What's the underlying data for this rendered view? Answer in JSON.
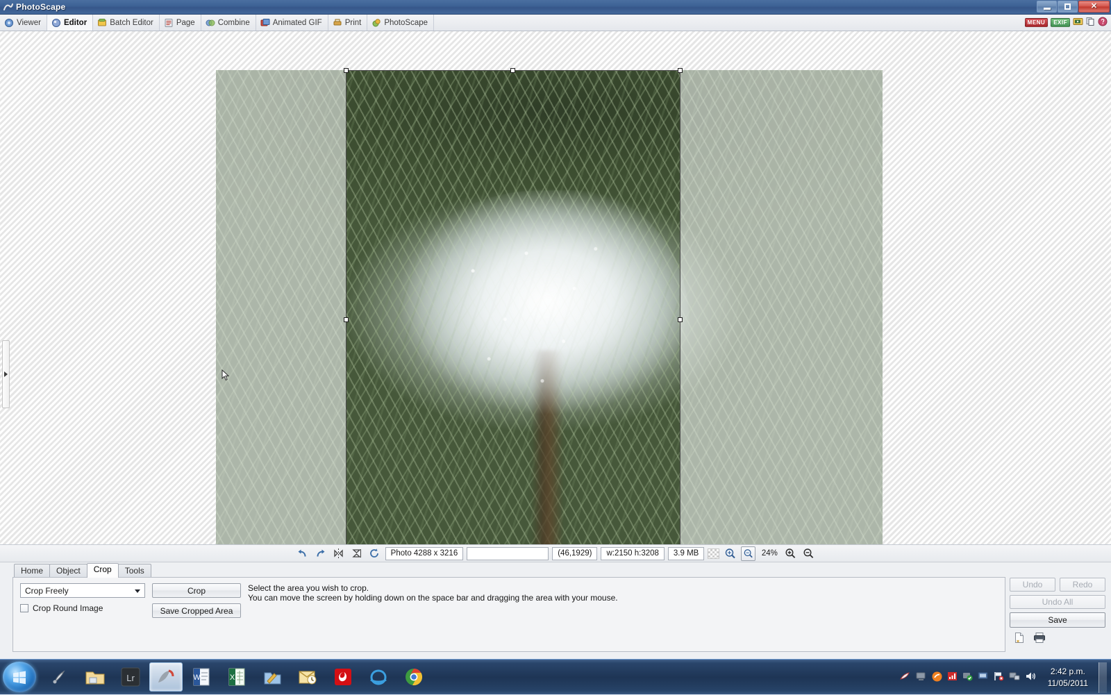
{
  "window": {
    "title": "PhotoScape",
    "icon": "photoscape-logo-icon",
    "controls": {
      "minimize": "minimize-button",
      "restore": "restore-button",
      "close": "close-button"
    }
  },
  "modebar": {
    "items": [
      {
        "label": "Viewer",
        "icon": "viewer-icon",
        "active": false
      },
      {
        "label": "Editor",
        "icon": "editor-icon",
        "active": true
      },
      {
        "label": "Batch Editor",
        "icon": "batch-editor-icon",
        "active": false
      },
      {
        "label": "Page",
        "icon": "page-icon",
        "active": false
      },
      {
        "label": "Combine",
        "icon": "combine-icon",
        "active": false
      },
      {
        "label": "Animated GIF",
        "icon": "animated-gif-icon",
        "active": false
      },
      {
        "label": "Print",
        "icon": "print-icon",
        "active": false
      },
      {
        "label": "PhotoScape",
        "icon": "photoscape-icon",
        "active": false
      }
    ],
    "utility_icons": [
      {
        "label": "MENU",
        "name": "menu-badge"
      },
      {
        "label": "EXIF",
        "name": "exif-badge"
      },
      {
        "label": "",
        "name": "slideshow-icon"
      },
      {
        "label": "",
        "name": "copy-icon"
      },
      {
        "label": "",
        "name": "help-icon"
      }
    ]
  },
  "canvas": {
    "grip": "panel-collapse-grip",
    "crop_selection": {
      "label": "crop-selection-rectangle",
      "handles": 8
    }
  },
  "imagebar": {
    "undo_icon": "undo-icon",
    "redo_icon": "redo-icon",
    "flip_horizontal_icon": "flip-horizontal-icon",
    "flip_vertical_icon": "flip-vertical-icon",
    "rotate_icon": "rotate-icon",
    "photo_size": "Photo 4288 x 3216",
    "filename_value": "",
    "filename_placeholder": "",
    "cursor_position": "(46,1929)",
    "selection_size": "w:2150 h:3208",
    "file_size": "3.9 MB",
    "transparency_icon": "transparency-checker-icon",
    "zoom_fit_icon": "zoom-fit-icon",
    "zoom_actual_icon": "zoom-actual-size-icon",
    "zoom_level": "24%",
    "zoom_in_icon": "zoom-in-icon",
    "zoom_out_icon": "zoom-out-icon"
  },
  "tools": {
    "tabs": [
      {
        "label": "Home",
        "active": false
      },
      {
        "label": "Object",
        "active": false
      },
      {
        "label": "Crop",
        "active": true
      },
      {
        "label": "Tools",
        "active": false
      }
    ],
    "crop_mode": "Crop Freely",
    "crop_round_label": "Crop Round Image",
    "crop_round_checked": false,
    "crop_button": "Crop",
    "save_cropped_button": "Save Cropped Area",
    "instructions": [
      "Select the area you wish to crop.",
      "You can move the screen by holding down on the space bar and dragging the area with your mouse."
    ]
  },
  "actions": {
    "undo": "Undo",
    "redo": "Redo",
    "undo_all": "Undo All",
    "save": "Save",
    "new_file_icon": "new-file-icon",
    "print_icon": "print-icon"
  },
  "taskbar": {
    "start": "start-orb",
    "items": [
      {
        "name": "taskbar-item-snagit",
        "active": false
      },
      {
        "name": "taskbar-item-explorer",
        "active": false
      },
      {
        "name": "taskbar-item-lightroom",
        "label": "Lr",
        "active": false
      },
      {
        "name": "taskbar-item-photoscape",
        "active": true
      },
      {
        "name": "taskbar-item-word",
        "label": "W",
        "active": false
      },
      {
        "name": "taskbar-item-excel",
        "label": "X",
        "active": false
      },
      {
        "name": "taskbar-item-paint",
        "active": false
      },
      {
        "name": "taskbar-item-outlook",
        "active": false
      },
      {
        "name": "taskbar-item-vodafone",
        "active": false
      },
      {
        "name": "taskbar-item-internet-explorer",
        "active": false
      },
      {
        "name": "taskbar-item-chrome",
        "active": false
      }
    ],
    "tray_icons": [
      "tray-icon-snagit",
      "tray-icon-display",
      "tray-icon-orange",
      "tray-icon-chart",
      "tray-icon-security",
      "tray-icon-monitor",
      "tray-icon-flag",
      "tray-icon-network",
      "tray-icon-volume"
    ],
    "clock_time": "2:42 p.m.",
    "clock_date": "11/05/2011"
  },
  "colors": {
    "titlebar": "#3e6396",
    "accent": "#c0372d",
    "panel": "#eef0f3",
    "taskbar": "#1c3a63"
  }
}
